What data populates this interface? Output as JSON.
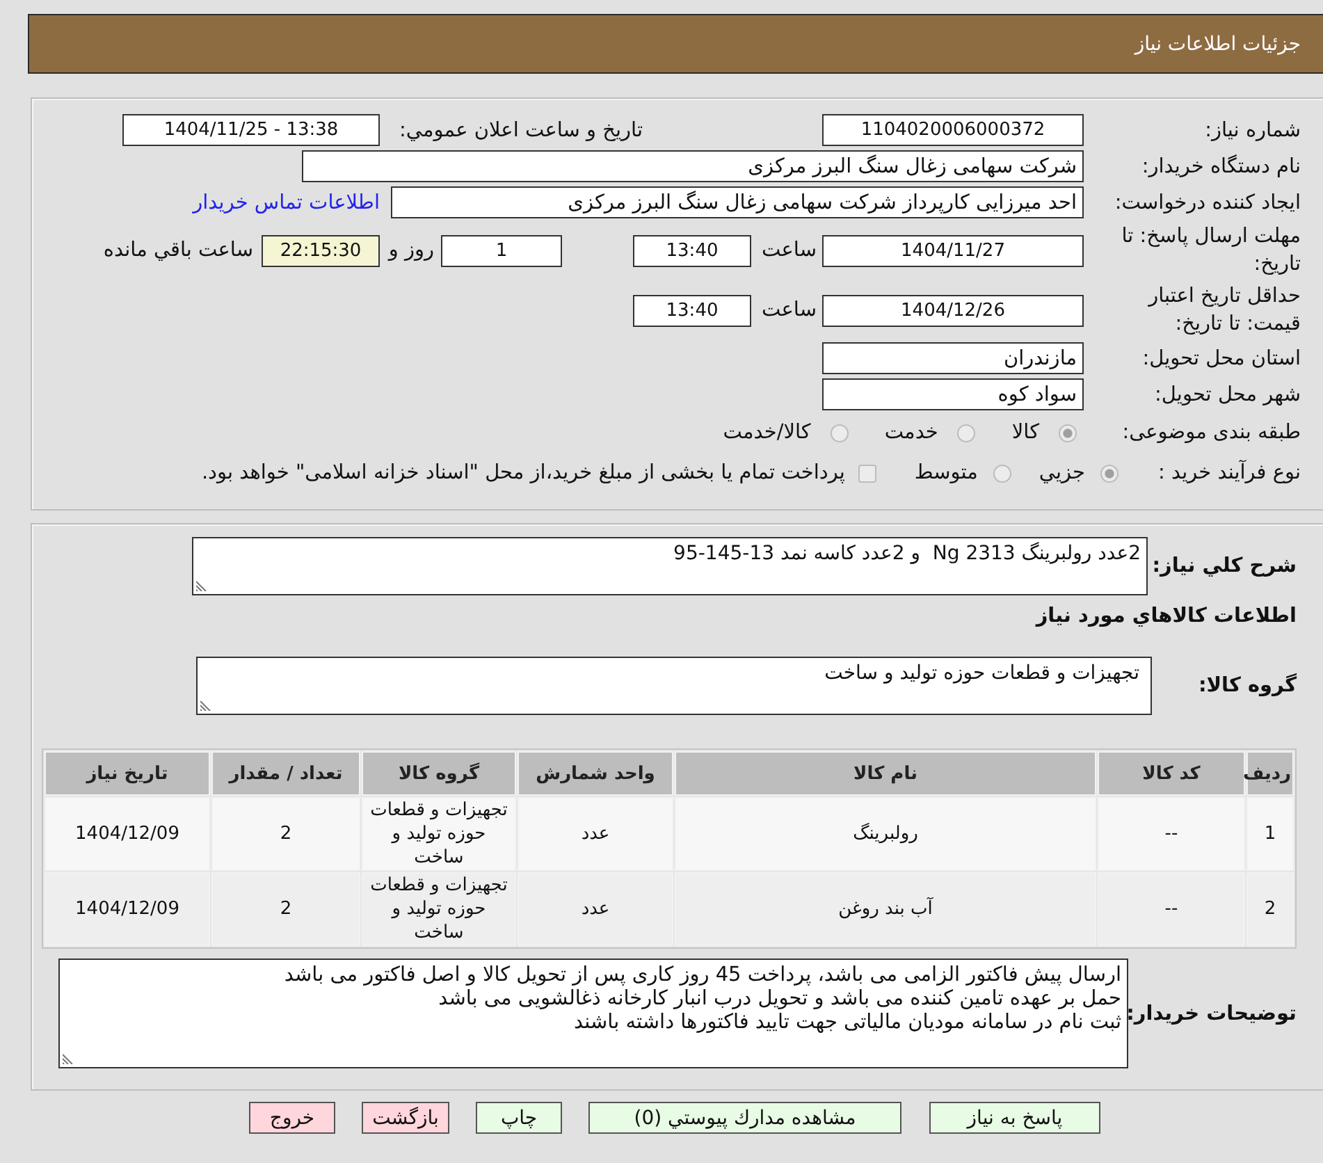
{
  "header": {
    "title": "جزئیات اطلاعات نیاز"
  },
  "need_info": {
    "need_number": {
      "label": "شماره نیاز:",
      "value": "1104020006000372"
    },
    "announce_datetime": {
      "label": "تاریخ و ساعت اعلان عمومي:",
      "value": "1404/11/25 - 13:38"
    },
    "buyer_org": {
      "label": "نام دستگاه خریدار:",
      "value": "شرکت سهامی زغال سنگ البرز مرکزی"
    },
    "requester": {
      "label": "ایجاد کننده درخواست:",
      "value": "احد میرزایی کارپرداز شرکت سهامی زغال سنگ البرز مرکزی",
      "link": "اطلاعات تماس خریدار"
    },
    "response_deadline": {
      "label": "مهلت ارسال پاسخ: تا تاریخ:",
      "date": "1404/11/27",
      "time_label": "ساعت",
      "time": "13:40",
      "days": "1",
      "days_label": "روز و",
      "remaining": "22:15:30",
      "remaining_label": "ساعت باقي مانده"
    },
    "price_validity": {
      "label": "حداقل تاريخ اعتبار قیمت: تا تاریخ:",
      "date": "1404/12/26",
      "time_label": "ساعت",
      "time": "13:40"
    },
    "delivery_province": {
      "label": "استان محل تحویل:",
      "value": "مازندران"
    },
    "delivery_city": {
      "label": "شهر محل تحویل:",
      "value": "سواد کوه"
    },
    "subject_category": {
      "label": "طبقه بندی موضوعی:",
      "options": [
        {
          "label": "کالا",
          "selected": true
        },
        {
          "label": "خدمت",
          "selected": false
        },
        {
          "label": "کالا/خدمت",
          "selected": false
        }
      ]
    },
    "purchase_process": {
      "label": "نوع فرآیند خرید :",
      "options": [
        {
          "label": "جزيي",
          "selected": true
        },
        {
          "label": "متوسط",
          "selected": false
        }
      ],
      "treasury": {
        "label": "پرداخت تمام یا بخشی از مبلغ خرید،از محل \"اسناد خزانه اسلامی\" خواهد بود.",
        "checked": false
      }
    }
  },
  "need_details": {
    "description": {
      "label": "شرح کلي نیاز:",
      "value": "2عدد رولبرینگ Ng 2313  و 2عدد کاسه نمد 13-145-95"
    },
    "goods_heading": "اطلاعات کالاهاي مورد نیاز",
    "goods_group": {
      "label": "گروه کالا:",
      "value": "تجهیزات و قطعات حوزه تولید و ساخت"
    },
    "table": {
      "columns": [
        "ردیف",
        "کد کالا",
        "نام کالا",
        "واحد شمارش",
        "گروه کالا",
        "تعداد / مقدار",
        "تاریخ نیاز"
      ],
      "rows": [
        [
          "1",
          "--",
          "رولبرینگ",
          "عدد",
          "تجهیزات و قطعات حوزه تولید و ساخت",
          "2",
          "1404/12/09"
        ],
        [
          "2",
          "--",
          "آب بند روغن",
          "عدد",
          "تجهیزات و قطعات حوزه تولید و ساخت",
          "2",
          "1404/12/09"
        ]
      ]
    },
    "buyer_notes": {
      "label": "توضیحات خریدار:",
      "value": "ارسال پیش فاکتور الزامی می باشد، پرداخت 45 روز کاری پس از تحویل کالا و اصل فاکتور می باشد\nحمل بر عهده تامین کننده می باشد و تحویل درب انبار کارخانه ذغالشویی می باشد\nثبت نام در سامانه مودیان مالیاتی جهت تایید فاکتورها داشته باشند"
    }
  },
  "buttons": [
    {
      "label": "پاسخ به نیاز",
      "kind": "primary"
    },
    {
      "label": "مشاهده مدارك پیوستي (0)",
      "kind": "primary"
    },
    {
      "label": "چاپ",
      "kind": "primary"
    },
    {
      "label": "بازگشت",
      "kind": "danger"
    },
    {
      "label": "خروج",
      "kind": "danger"
    }
  ]
}
